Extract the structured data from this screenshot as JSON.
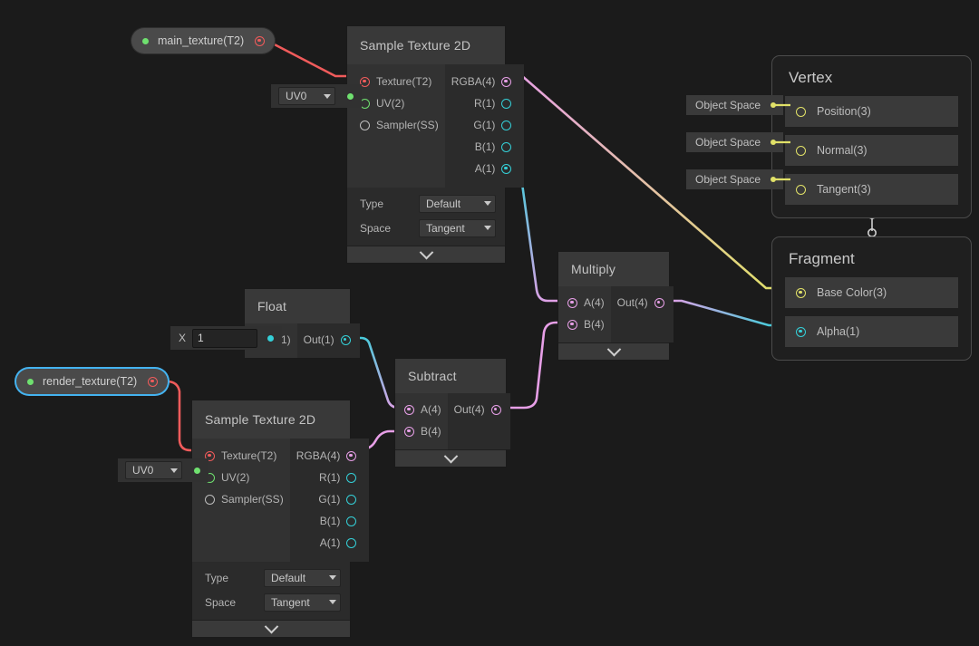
{
  "graph": {
    "background": "#1b1b1b",
    "accent_selected": "#44b3f0"
  },
  "properties": [
    {
      "name": "main_texture(T2)",
      "selected": false
    },
    {
      "name": "render_texture(T2)",
      "selected": true
    }
  ],
  "uv_widgets": [
    {
      "value": "UV0"
    },
    {
      "value": "UV0"
    }
  ],
  "nodes": {
    "sample_texture_top": {
      "title": "Sample Texture 2D",
      "inputs": [
        {
          "label": "Texture(T2)",
          "type": "texture",
          "connected": true
        },
        {
          "label": "UV(2)",
          "type": "uv",
          "connected": false
        },
        {
          "label": "Sampler(SS)",
          "type": "sampler",
          "connected": false
        }
      ],
      "outputs": [
        {
          "label": "RGBA(4)",
          "type": "vector4",
          "connected": true
        },
        {
          "label": "R(1)",
          "type": "vector1",
          "connected": false
        },
        {
          "label": "G(1)",
          "type": "vector1",
          "connected": false
        },
        {
          "label": "B(1)",
          "type": "vector1",
          "connected": false
        },
        {
          "label": "A(1)",
          "type": "vector1",
          "connected": true
        }
      ],
      "settings": [
        {
          "label": "Type",
          "value": "Default"
        },
        {
          "label": "Space",
          "value": "Tangent"
        }
      ]
    },
    "sample_texture_bottom": {
      "title": "Sample Texture 2D",
      "inputs": [
        {
          "label": "Texture(T2)",
          "type": "texture",
          "connected": true
        },
        {
          "label": "UV(2)",
          "type": "uv",
          "connected": false
        },
        {
          "label": "Sampler(SS)",
          "type": "sampler",
          "connected": false
        }
      ],
      "outputs": [
        {
          "label": "RGBA(4)",
          "type": "vector4",
          "connected": true
        },
        {
          "label": "R(1)",
          "type": "vector1",
          "connected": false
        },
        {
          "label": "G(1)",
          "type": "vector1",
          "connected": false
        },
        {
          "label": "B(1)",
          "type": "vector1",
          "connected": false
        },
        {
          "label": "A(1)",
          "type": "vector1",
          "connected": false
        }
      ],
      "settings": [
        {
          "label": "Type",
          "value": "Default"
        },
        {
          "label": "Space",
          "value": "Tangent"
        }
      ]
    },
    "float": {
      "title": "Float",
      "inputs": [
        {
          "label": "X(1)",
          "type": "vector1",
          "connected": false
        }
      ],
      "outputs": [
        {
          "label": "Out(1)",
          "type": "vector1",
          "connected": true
        }
      ],
      "field": {
        "label": "X",
        "value": "1"
      }
    },
    "subtract": {
      "title": "Subtract",
      "inputs": [
        {
          "label": "A(4)",
          "type": "vector4",
          "connected": true
        },
        {
          "label": "B(4)",
          "type": "vector4",
          "connected": true
        }
      ],
      "outputs": [
        {
          "label": "Out(4)",
          "type": "vector4",
          "connected": true
        }
      ]
    },
    "multiply": {
      "title": "Multiply",
      "inputs": [
        {
          "label": "A(4)",
          "type": "vector4",
          "connected": true
        },
        {
          "label": "B(4)",
          "type": "vector4",
          "connected": true
        }
      ],
      "outputs": [
        {
          "label": "Out(4)",
          "type": "vector4",
          "connected": true
        }
      ]
    }
  },
  "master_stack": {
    "vertex": {
      "title": "Vertex",
      "blocks": [
        {
          "label": "Position(3)",
          "space": "Object Space"
        },
        {
          "label": "Normal(3)",
          "space": "Object Space"
        },
        {
          "label": "Tangent(3)",
          "space": "Object Space"
        }
      ]
    },
    "fragment": {
      "title": "Fragment",
      "blocks": [
        {
          "label": "Base Color(3)",
          "slot": "vector3"
        },
        {
          "label": "Alpha(1)",
          "slot": "vector1"
        }
      ]
    }
  },
  "wire_colors": {
    "texture": "#f05b5b",
    "uv": "#6fe06f",
    "vector4": "#e79fe7",
    "vector1": "#34d0d8",
    "vector3": "#e1e168"
  }
}
